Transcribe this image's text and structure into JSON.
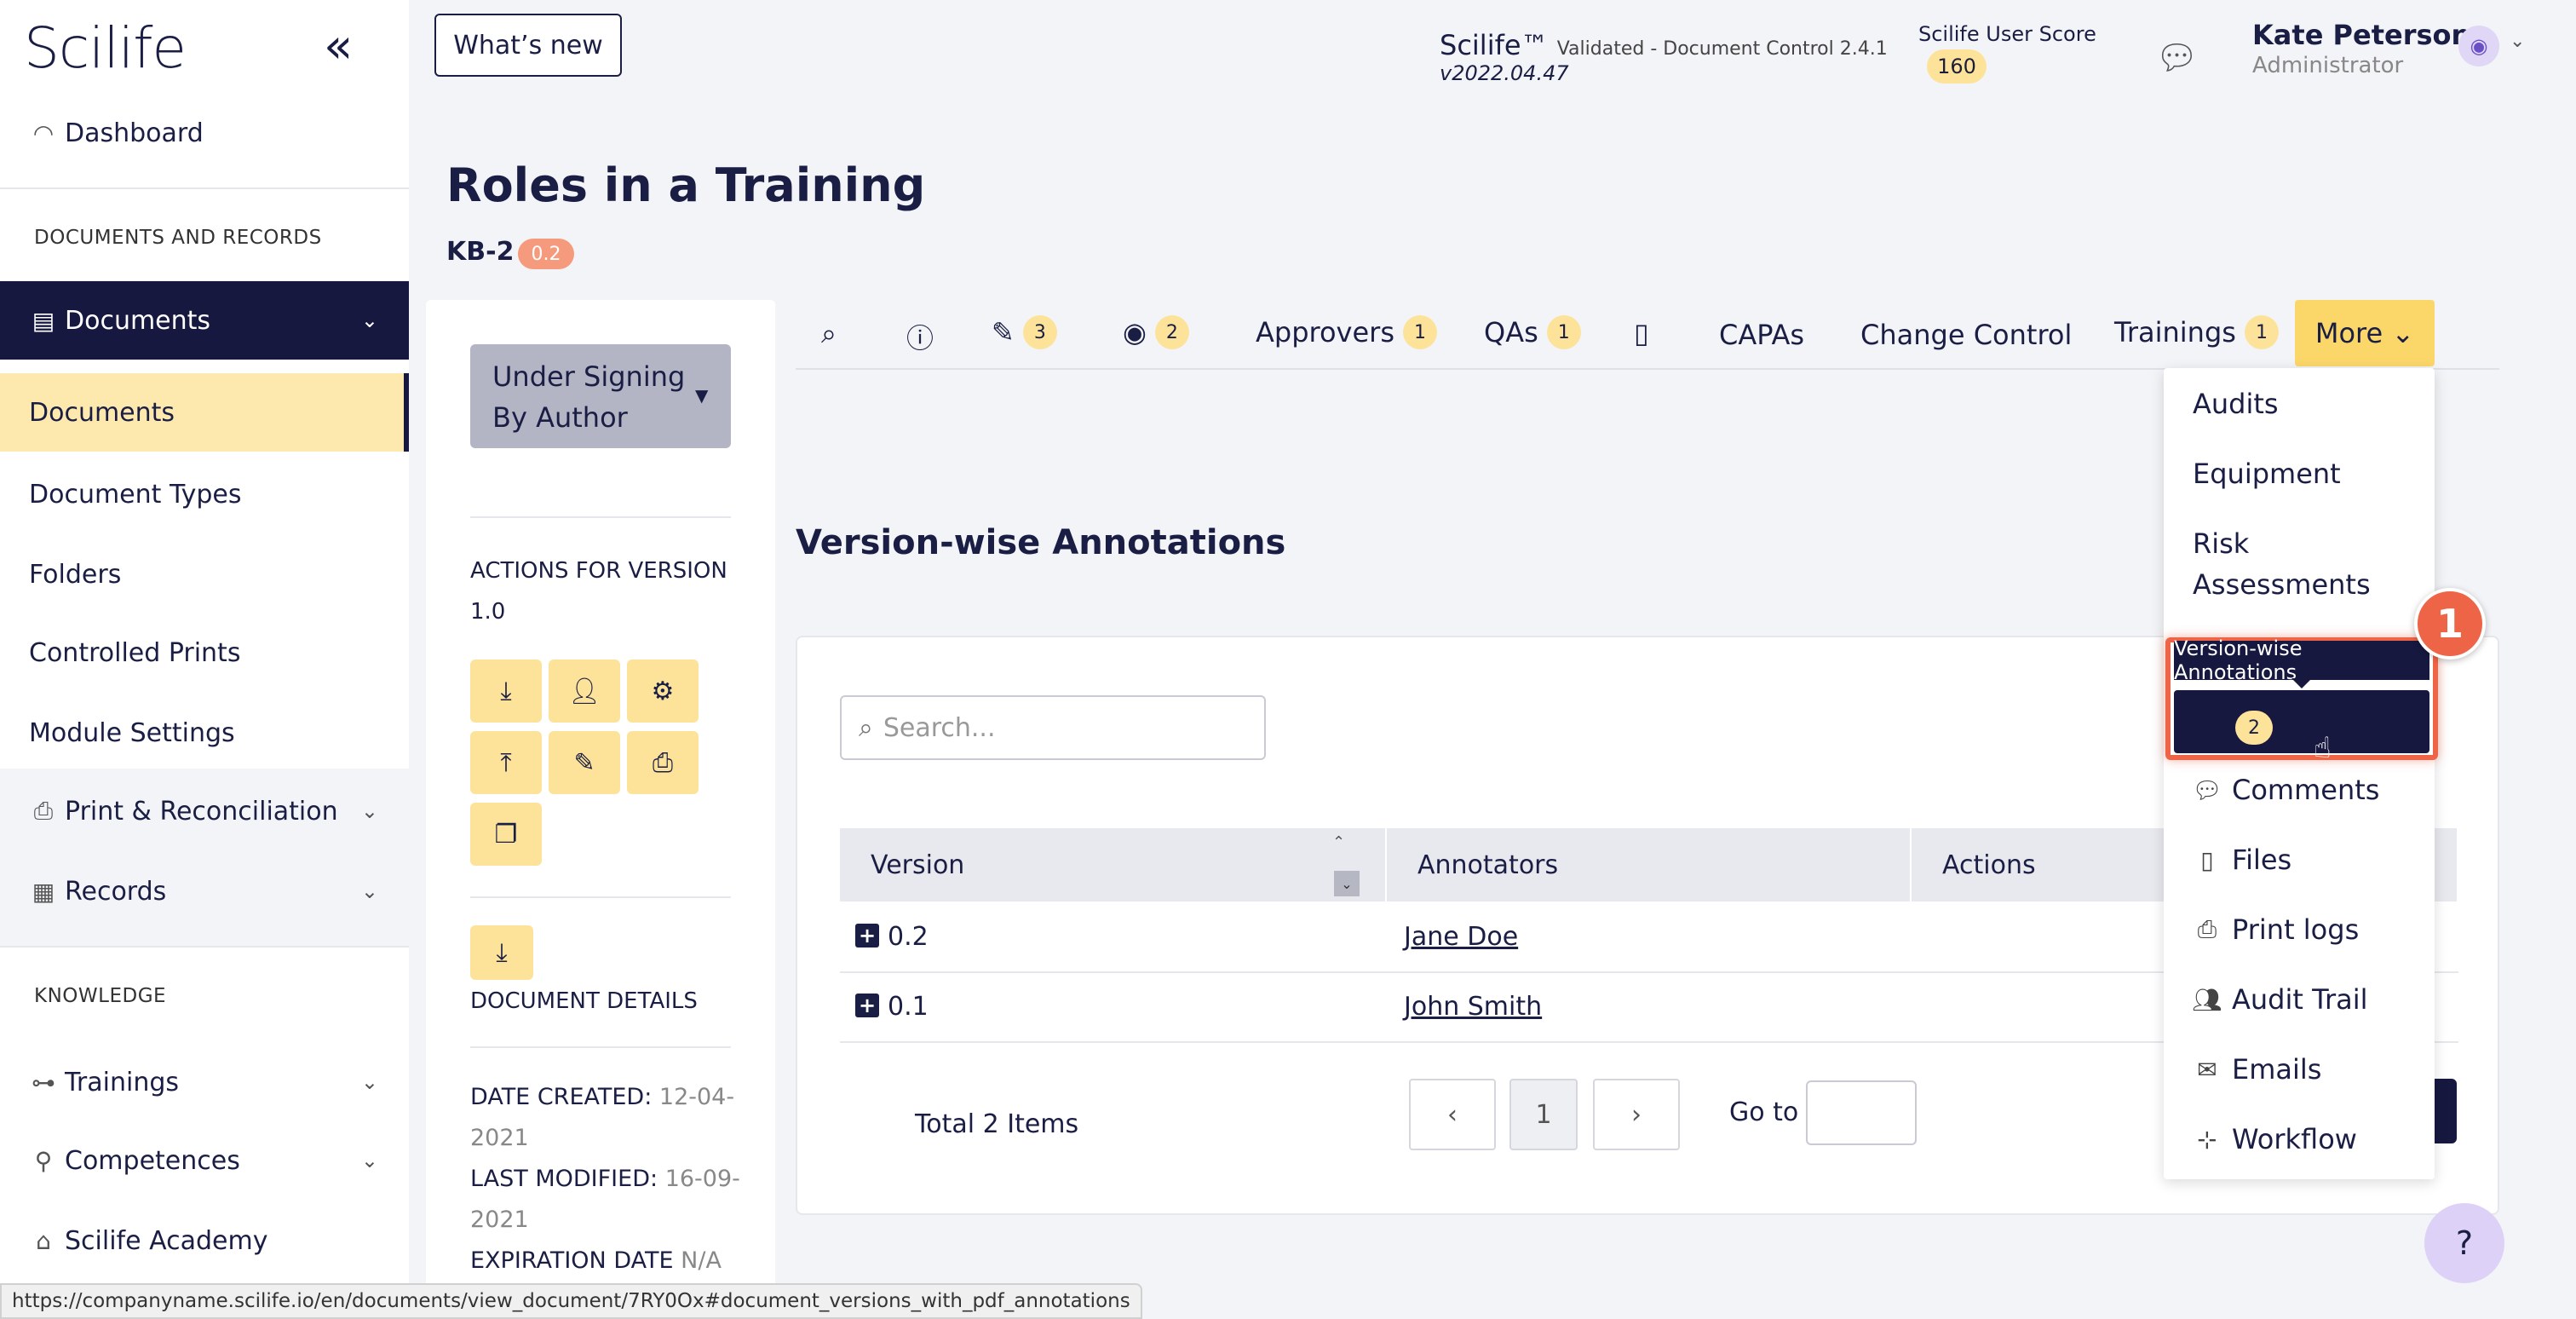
{
  "app": {
    "logo": "Scilife"
  },
  "header": {
    "whats_new": "What’s new",
    "product": "Scilife™",
    "product_sub": "Validated - Document Control 2.4.1",
    "version": "v2022.04.47",
    "score_label": "Scilife User Score",
    "score_value": "160",
    "user_name": "Kate Peterson",
    "user_role": "Administrator"
  },
  "sidebar": {
    "dashboard": "Dashboard",
    "section_docs": "DOCUMENTS AND RECORDS",
    "documents": "Documents",
    "sub": [
      "Documents",
      "Document Types",
      "Folders",
      "Controlled Prints",
      "Module Settings"
    ],
    "print": "Print & Reconciliation",
    "records": "Records",
    "section_knowledge": "KNOWLEDGE",
    "trainings": "Trainings",
    "competences": "Competences",
    "academy": "Scilife Academy"
  },
  "page": {
    "title": "Roles in a Training",
    "doc_id": "KB-2",
    "doc_version": "0.2"
  },
  "left_panel": {
    "status_label": "Under Signing By Author",
    "actions_title": "ACTIONS FOR VERSION 1.0",
    "details_title": "DOCUMENT DETAILS",
    "date_created_label": "DATE CREATED:",
    "date_created": "12-04-2021",
    "last_modified_label": "LAST MODIFIED:",
    "last_modified": "16-09-2021",
    "expiration_label": "EXPIRATION DATE",
    "expiration": "N/A"
  },
  "tabs": {
    "edit_count": "3",
    "view_count": "2",
    "approvers": "Approvers",
    "approvers_count": "1",
    "qas": "QAs",
    "qas_count": "1",
    "capas": "CAPAs",
    "change_control": "Change Control",
    "trainings": "Trainings",
    "trainings_count": "1",
    "more": "More"
  },
  "main": {
    "section_title": "Version-wise Annotations",
    "search_placeholder": "Search...",
    "columns": [
      "Version",
      "Annotators",
      "Actions"
    ],
    "rows": [
      {
        "version": "0.2",
        "annotator": "Jane Doe"
      },
      {
        "version": "0.1",
        "annotator": "John Smith"
      }
    ],
    "total": "Total 2 Items",
    "current_page": "1",
    "goto_label": "Go to"
  },
  "more_menu": {
    "items": [
      "Audits",
      "Equipment",
      "Risk Assessments"
    ],
    "tooltip": "Version-wise Annotations",
    "highlight_count": "2",
    "step": "1",
    "icon_items": [
      "Comments",
      "Files",
      "Print logs",
      "Audit Trail",
      "Emails",
      "Workflow"
    ]
  },
  "status_url": "https://companyname.scilife.io/en/documents/view_document/7RY0Ox#document_versions_with_pdf_annotations"
}
